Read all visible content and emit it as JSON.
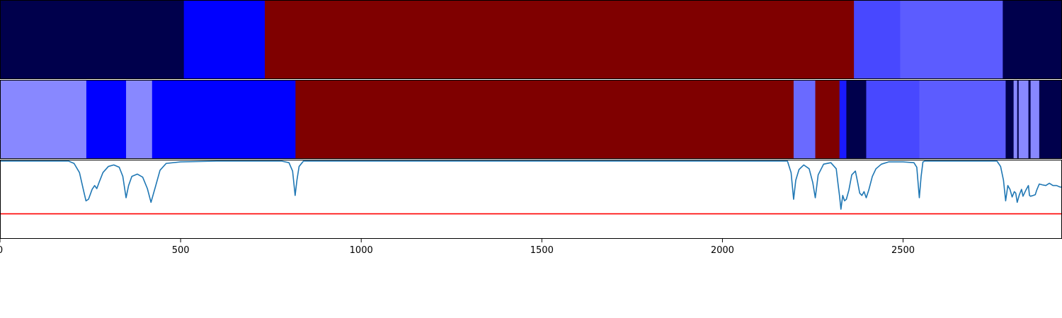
{
  "chart_data": {
    "type": "heatmap",
    "title": "",
    "xlabel": "",
    "ylabel": "",
    "xlim": [
      0,
      2940
    ],
    "x_ticks": [
      0,
      500,
      1000,
      1500,
      2000,
      2500
    ],
    "x_tick_labels": [
      "0",
      "500",
      "1000",
      "1500",
      "2000",
      "2500"
    ],
    "grid": false,
    "legend": "none",
    "tracks": [
      {
        "segments": [
          {
            "start": 0,
            "end": 509,
            "color": "#00004c"
          },
          {
            "start": 509,
            "end": 733,
            "color": "#0000ff"
          },
          {
            "start": 733,
            "end": 2364,
            "color": "#7f0000"
          },
          {
            "start": 2364,
            "end": 2492,
            "color": "#4848ff"
          },
          {
            "start": 2492,
            "end": 2776,
            "color": "#5c5cff"
          },
          {
            "start": 2776,
            "end": 2940,
            "color": "#00004c"
          }
        ]
      },
      {
        "segments": [
          {
            "start": 0,
            "end": 239,
            "color": "#8888ff"
          },
          {
            "start": 239,
            "end": 349,
            "color": "#0000ff"
          },
          {
            "start": 349,
            "end": 421,
            "color": "#8888ff"
          },
          {
            "start": 421,
            "end": 818,
            "color": "#0000ff"
          },
          {
            "start": 818,
            "end": 2197,
            "color": "#7f0000"
          },
          {
            "start": 2197,
            "end": 2257,
            "color": "#6a6aff"
          },
          {
            "start": 2257,
            "end": 2324,
            "color": "#7f0000"
          },
          {
            "start": 2324,
            "end": 2343,
            "color": "#1a1aff"
          },
          {
            "start": 2343,
            "end": 2398,
            "color": "#00004c"
          },
          {
            "start": 2398,
            "end": 2545,
            "color": "#4848ff"
          },
          {
            "start": 2545,
            "end": 2784,
            "color": "#5c5cff"
          },
          {
            "start": 2784,
            "end": 2806,
            "color": "#00004c"
          },
          {
            "start": 2806,
            "end": 2816,
            "color": "#8888ff"
          },
          {
            "start": 2816,
            "end": 2820,
            "color": "#00004c"
          },
          {
            "start": 2820,
            "end": 2847,
            "color": "#8888ff"
          },
          {
            "start": 2847,
            "end": 2853,
            "color": "#00004c"
          },
          {
            "start": 2853,
            "end": 2877,
            "color": "#8888ff"
          },
          {
            "start": 2877,
            "end": 2940,
            "color": "#00004c"
          }
        ]
      }
    ],
    "line_panel": {
      "ylim": [
        0,
        1
      ],
      "threshold": {
        "value": 0.31,
        "color": "#ff0000"
      },
      "series": [
        {
          "color": "#1f77b4",
          "points": [
            [
              0,
              1.0
            ],
            [
              190,
              1.0
            ],
            [
              205,
              0.97
            ],
            [
              220,
              0.85
            ],
            [
              232,
              0.6
            ],
            [
              238,
              0.48
            ],
            [
              245,
              0.5
            ],
            [
              255,
              0.63
            ],
            [
              262,
              0.68
            ],
            [
              268,
              0.64
            ],
            [
              275,
              0.73
            ],
            [
              285,
              0.85
            ],
            [
              300,
              0.93
            ],
            [
              315,
              0.95
            ],
            [
              330,
              0.92
            ],
            [
              340,
              0.8
            ],
            [
              349,
              0.52
            ],
            [
              356,
              0.68
            ],
            [
              365,
              0.8
            ],
            [
              380,
              0.83
            ],
            [
              395,
              0.79
            ],
            [
              408,
              0.64
            ],
            [
              418,
              0.46
            ],
            [
              430,
              0.66
            ],
            [
              443,
              0.88
            ],
            [
              460,
              0.97
            ],
            [
              500,
              0.99
            ],
            [
              600,
              1.0
            ],
            [
              700,
              1.0
            ],
            [
              780,
              1.0
            ],
            [
              800,
              0.98
            ],
            [
              810,
              0.87
            ],
            [
              817,
              0.55
            ],
            [
              822,
              0.75
            ],
            [
              828,
              0.93
            ],
            [
              840,
              1.0
            ],
            [
              2160,
              1.0
            ],
            [
              2180,
              1.0
            ],
            [
              2190,
              0.85
            ],
            [
              2197,
              0.5
            ],
            [
              2203,
              0.75
            ],
            [
              2212,
              0.89
            ],
            [
              2225,
              0.95
            ],
            [
              2240,
              0.9
            ],
            [
              2250,
              0.72
            ],
            [
              2257,
              0.52
            ],
            [
              2265,
              0.82
            ],
            [
              2280,
              0.96
            ],
            [
              2300,
              0.98
            ],
            [
              2315,
              0.9
            ],
            [
              2320,
              0.7
            ],
            [
              2324,
              0.55
            ],
            [
              2328,
              0.37
            ],
            [
              2333,
              0.55
            ],
            [
              2338,
              0.48
            ],
            [
              2343,
              0.5
            ],
            [
              2350,
              0.62
            ],
            [
              2358,
              0.82
            ],
            [
              2368,
              0.87
            ],
            [
              2374,
              0.73
            ],
            [
              2380,
              0.58
            ],
            [
              2386,
              0.55
            ],
            [
              2392,
              0.6
            ],
            [
              2398,
              0.52
            ],
            [
              2405,
              0.62
            ],
            [
              2415,
              0.8
            ],
            [
              2425,
              0.9
            ],
            [
              2440,
              0.96
            ],
            [
              2460,
              0.99
            ],
            [
              2500,
              0.99
            ],
            [
              2530,
              0.98
            ],
            [
              2538,
              0.92
            ],
            [
              2545,
              0.52
            ],
            [
              2550,
              0.8
            ],
            [
              2555,
              0.99
            ],
            [
              2560,
              1.0
            ],
            [
              2690,
              1.0
            ],
            [
              2760,
              1.0
            ],
            [
              2770,
              0.93
            ],
            [
              2778,
              0.75
            ],
            [
              2784,
              0.48
            ],
            [
              2790,
              0.68
            ],
            [
              2796,
              0.63
            ],
            [
              2802,
              0.53
            ],
            [
              2808,
              0.6
            ],
            [
              2812,
              0.58
            ],
            [
              2816,
              0.46
            ],
            [
              2822,
              0.56
            ],
            [
              2828,
              0.63
            ],
            [
              2832,
              0.54
            ],
            [
              2840,
              0.62
            ],
            [
              2847,
              0.68
            ],
            [
              2850,
              0.55
            ],
            [
              2853,
              0.54
            ],
            [
              2860,
              0.55
            ],
            [
              2866,
              0.56
            ],
            [
              2870,
              0.62
            ],
            [
              2877,
              0.7
            ],
            [
              2885,
              0.69
            ],
            [
              2895,
              0.68
            ],
            [
              2905,
              0.71
            ],
            [
              2915,
              0.68
            ],
            [
              2925,
              0.68
            ],
            [
              2935,
              0.66
            ],
            [
              2940,
              0.66
            ]
          ]
        }
      ]
    }
  }
}
